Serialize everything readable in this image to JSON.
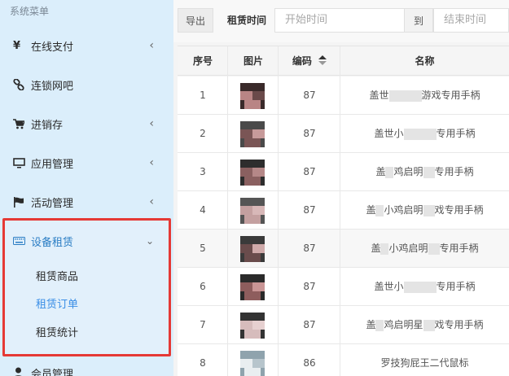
{
  "sidebar": {
    "header": "系统菜单",
    "items": [
      {
        "label": "在线支付",
        "icon": "yen-icon",
        "has_arrow": true
      },
      {
        "label": "连锁网吧",
        "icon": "link-icon",
        "has_arrow": false
      },
      {
        "label": "进销存",
        "icon": "cart-icon",
        "has_arrow": true
      },
      {
        "label": "应用管理",
        "icon": "monitor-icon",
        "has_arrow": true
      },
      {
        "label": "活动管理",
        "icon": "flag-icon",
        "has_arrow": true
      },
      {
        "label": "设备租赁",
        "icon": "keyboard-icon",
        "has_arrow": true,
        "expanded": true
      },
      {
        "label": "会员管理",
        "icon": "user-icon",
        "has_arrow": false
      }
    ],
    "subitems": [
      {
        "label": "租赁商品"
      },
      {
        "label": "租赁订单",
        "current": true
      },
      {
        "label": "租赁统计"
      }
    ]
  },
  "toolbar": {
    "export_label": "导出",
    "rent_time_label": "租赁时间",
    "start_placeholder": "开始时间",
    "to_label": "到",
    "end_placeholder": "结束时间"
  },
  "table": {
    "headers": {
      "index": "序号",
      "image": "图片",
      "code": "编码",
      "name": "名称"
    },
    "rows": [
      {
        "index": "1",
        "code": "87",
        "name_prefix": "盖世",
        "name_suffix": "游戏专用手柄"
      },
      {
        "index": "2",
        "code": "87",
        "name_prefix": "盖世小",
        "name_suffix": "专用手柄"
      },
      {
        "index": "3",
        "code": "87",
        "name_prefix": "盖",
        "name_mid": "鸡启明",
        "name_suffix": "专用手柄"
      },
      {
        "index": "4",
        "code": "87",
        "name_prefix": "盖",
        "name_mid": "小鸡启明",
        "name_suffix": "戏专用手柄"
      },
      {
        "index": "5",
        "code": "87",
        "name_prefix": "盖",
        "name_mid": "小鸡启明",
        "name_suffix": "专用手柄"
      },
      {
        "index": "6",
        "code": "87",
        "name_prefix": "盖世小",
        "name_suffix": "专用手柄"
      },
      {
        "index": "7",
        "code": "87",
        "name_prefix": "盖",
        "name_mid": "鸡启明星",
        "name_suffix": "戏专用手柄"
      },
      {
        "index": "8",
        "code": "86",
        "name_prefix": "罗技狗屁王二代鼠标",
        "name_suffix": ""
      }
    ]
  },
  "colors": {
    "sidebar_bg": "#dbeefb",
    "accent": "#3a8ee6",
    "highlight_border": "#e53935"
  }
}
